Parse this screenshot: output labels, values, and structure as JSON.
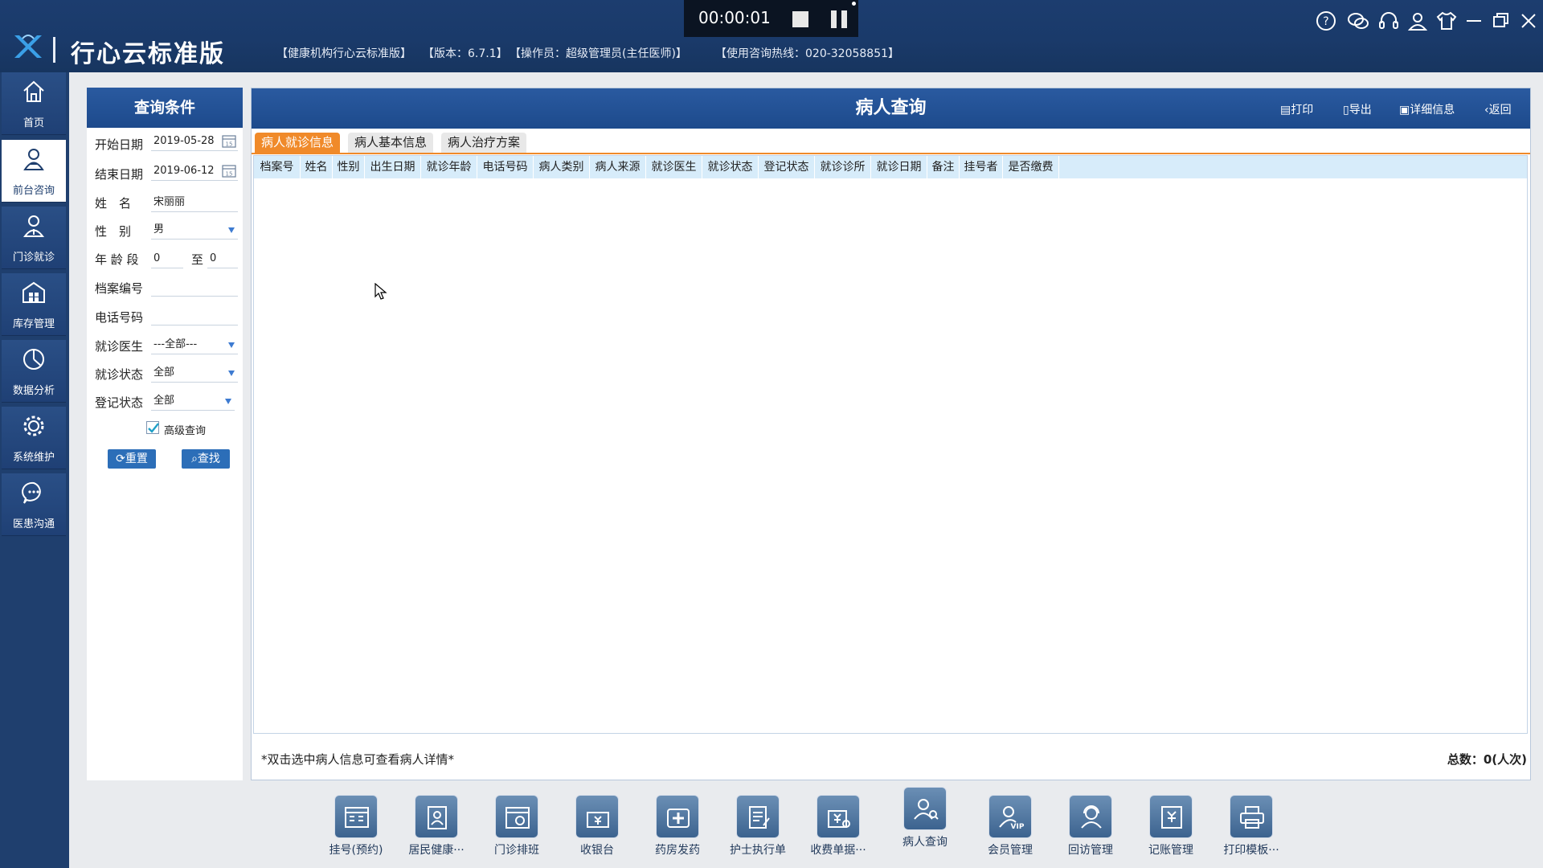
{
  "app": {
    "name": "行心云标准版",
    "org": "【健康机构行心云标准版】",
    "version": "【版本：6.7.1】",
    "operator": "【操作员：超级管理员(主任医师)】",
    "hotline": "【使用咨询热线：020-32058851】"
  },
  "recorder": {
    "time": "00:00:01"
  },
  "nav": [
    {
      "label": "首页",
      "icon": "home-icon"
    },
    {
      "label": "前台咨询",
      "icon": "receptionist-icon",
      "active": true
    },
    {
      "label": "门诊就诊",
      "icon": "doctor-icon"
    },
    {
      "label": "库存管理",
      "icon": "warehouse-icon"
    },
    {
      "label": "数据分析",
      "icon": "pie-chart-icon"
    },
    {
      "label": "系统维护",
      "icon": "gear-icon"
    },
    {
      "label": "医患沟通",
      "icon": "chat-icon"
    }
  ],
  "query": {
    "title": "查询条件",
    "start_date_label": "开始日期",
    "start_date": "2019-05-28",
    "end_date_label": "结束日期",
    "end_date": "2019-06-12",
    "name_label": "姓　名",
    "name_value": "宋丽丽",
    "gender_label": "性　别",
    "gender_value": "男",
    "age_label": "年 龄 段",
    "age_from": "0",
    "age_to_label": "至",
    "age_to": "0",
    "file_no_label": "档案编号",
    "file_no_value": "",
    "phone_label": "电话号码",
    "phone_value": "",
    "doctor_label": "就诊医生",
    "doctor_value": "---全部---",
    "visit_status_label": "就诊状态",
    "visit_status_value": "全部",
    "reg_status_label": "登记状态",
    "reg_status_value": "全部",
    "advanced_label": "高级查询",
    "advanced_checked": true,
    "reset_label": "重置",
    "search_label": "查找"
  },
  "result": {
    "title": "病人查询",
    "actions": {
      "print": "打印",
      "export": "导出",
      "detail": "详细信息",
      "back": "返回"
    },
    "tabs": [
      "病人就诊信息",
      "病人基本信息",
      "病人治疗方案"
    ],
    "active_tab": 0,
    "columns": [
      "档案号",
      "姓名",
      "性别",
      "出生日期",
      "就诊年龄",
      "电话号码",
      "病人类别",
      "病人来源",
      "就诊医生",
      "就诊状态",
      "登记状态",
      "就诊诊所",
      "就诊日期",
      "备注",
      "挂号者",
      "是否缴费"
    ],
    "rows": [],
    "footnote": "*双击选中病人信息可查看病人详情*",
    "total": "总数：0(人次)"
  },
  "toolbar": [
    {
      "label": "挂号(预约)",
      "icon": "register-icon"
    },
    {
      "label": "居民健康···",
      "icon": "health-record-icon"
    },
    {
      "label": "门诊排班",
      "icon": "schedule-icon"
    },
    {
      "label": "收银台",
      "icon": "cashier-icon"
    },
    {
      "label": "药房发药",
      "icon": "pharmacy-icon"
    },
    {
      "label": "护士执行单",
      "icon": "nurse-order-icon"
    },
    {
      "label": "收费单据···",
      "icon": "receipt-icon"
    },
    {
      "label": "病人查询",
      "icon": "patient-search-icon"
    },
    {
      "label": "会员管理",
      "icon": "vip-icon"
    },
    {
      "label": "回访管理",
      "icon": "follow-up-icon"
    },
    {
      "label": "记账管理",
      "icon": "ledger-icon"
    },
    {
      "label": "打印模板···",
      "icon": "printer-icon"
    }
  ]
}
